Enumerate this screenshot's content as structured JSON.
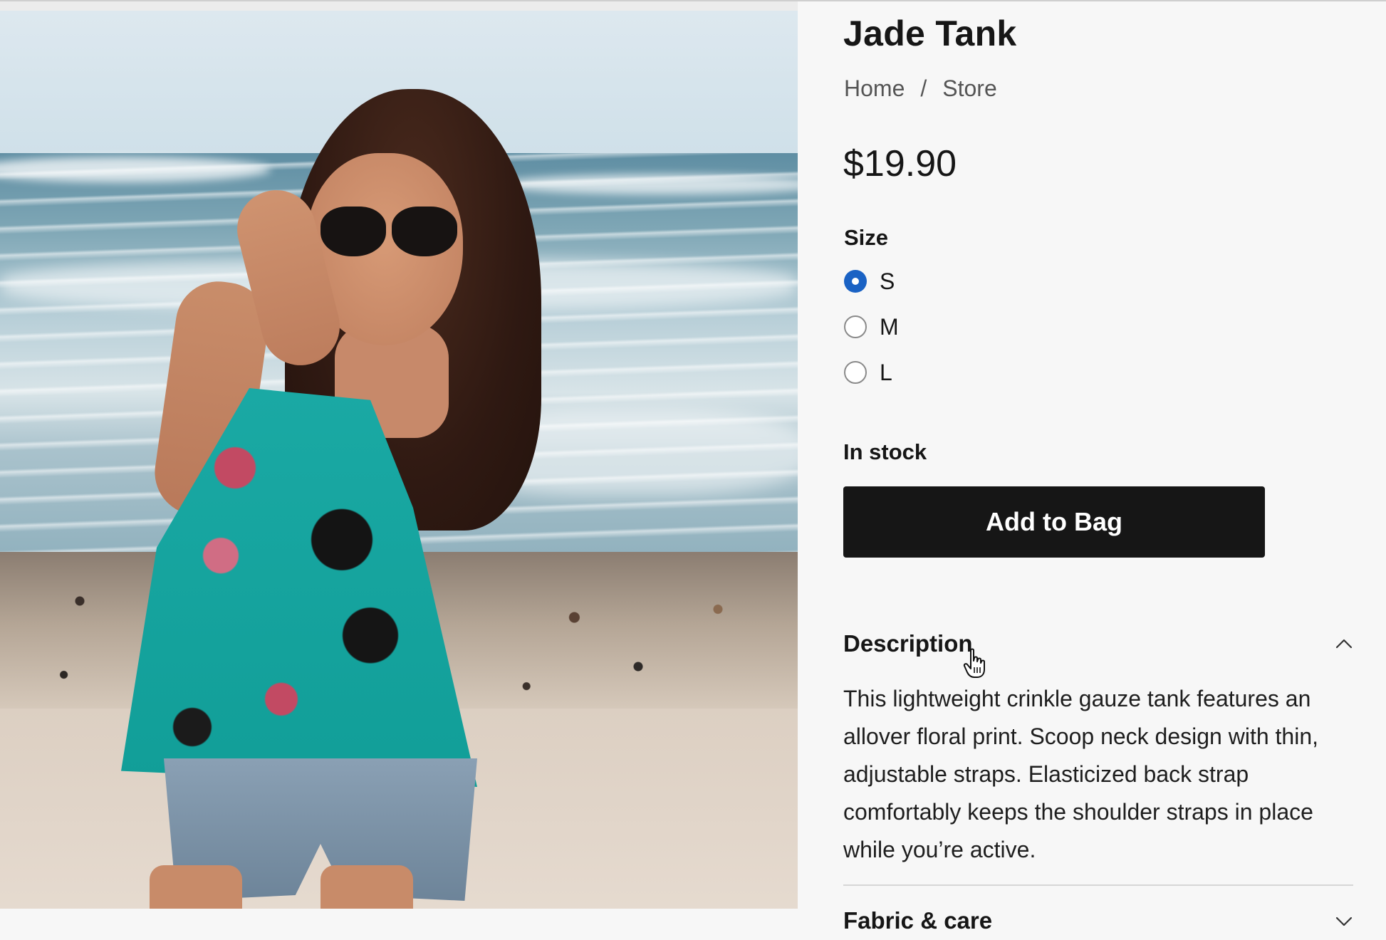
{
  "product": {
    "title": "Jade Tank",
    "price": "$19.90",
    "image_alt": "Woman on a beach wearing a teal floral tank and denim shorts"
  },
  "breadcrumb": {
    "items": [
      "Home",
      "Store"
    ],
    "separator": "/"
  },
  "size": {
    "label": "Size",
    "options": [
      {
        "label": "S",
        "selected": true
      },
      {
        "label": "M",
        "selected": false
      },
      {
        "label": "L",
        "selected": false
      }
    ]
  },
  "stock_status": "In stock",
  "add_to_bag_label": "Add to Bag",
  "description": {
    "title": "Description",
    "expanded": true,
    "text": "This lightweight crinkle gauze tank features an allover floral print. Scoop neck design with thin, adjustable straps. Elasticized back strap comfortably keeps the shoulder straps in place while you’re active."
  },
  "fabric_care": {
    "title": "Fabric & care",
    "expanded": false
  },
  "colors": {
    "primary_button": "#161616",
    "radio_selected": "#1a62c4",
    "background": "#f7f7f7"
  },
  "icons": {
    "collapse": "chevron-up-icon",
    "expand": "chevron-down-icon",
    "pointer": "hand-pointer-cursor-icon"
  }
}
